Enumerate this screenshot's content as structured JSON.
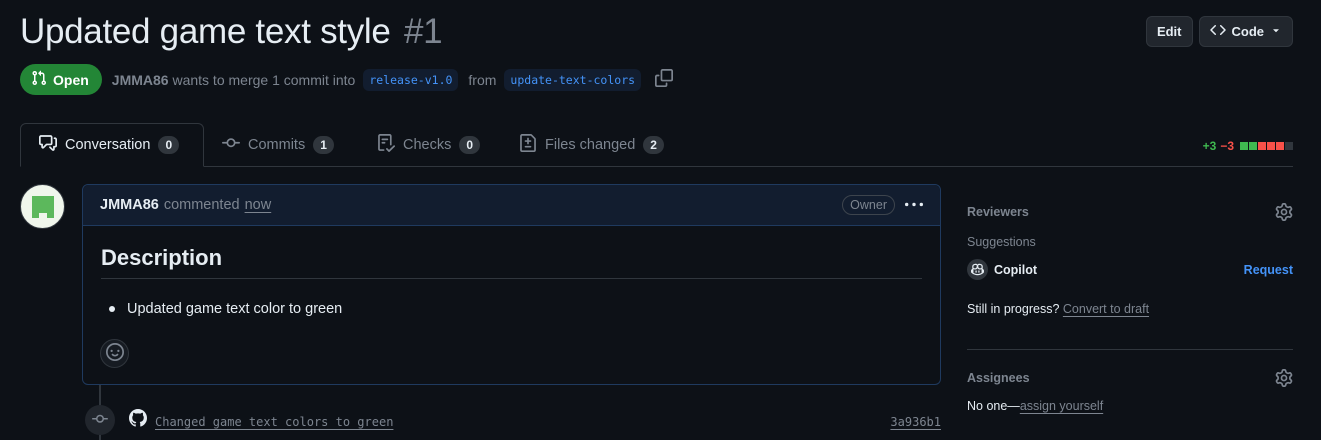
{
  "pr": {
    "title": "Updated game text style",
    "number": "#1",
    "state": "Open",
    "author": "JMMA86",
    "merge_text": "wants to merge 1 commit into",
    "base_branch": "release-v1.0",
    "from_text": "from",
    "head_branch": "update-text-colors"
  },
  "header_buttons": {
    "edit": "Edit",
    "code": "Code"
  },
  "tabs": [
    {
      "label": "Conversation",
      "count": "0",
      "active": true,
      "icon": "comment-discussion-icon"
    },
    {
      "label": "Commits",
      "count": "1",
      "active": false,
      "icon": "git-commit-icon"
    },
    {
      "label": "Checks",
      "count": "0",
      "active": false,
      "icon": "checklist-icon"
    },
    {
      "label": "Files changed",
      "count": "2",
      "active": false,
      "icon": "file-diff-icon"
    }
  ],
  "diffstat": {
    "additions": "+3",
    "deletions": "−3",
    "blocks": [
      "add",
      "add",
      "del",
      "del",
      "del",
      "neutral"
    ],
    "colors": {
      "add": "#3fb950",
      "del": "#f85149",
      "neutral": "#30363d"
    }
  },
  "comment": {
    "author": "JMMA86",
    "action": "commented",
    "time": "now",
    "badge": "Owner",
    "heading": "Description",
    "items": [
      "Updated game text color to green"
    ]
  },
  "timeline": {
    "commit_message": "Changed game text colors to green",
    "commit_sha": "3a936b1"
  },
  "sidebar": {
    "reviewers": {
      "heading": "Reviewers",
      "suggestions_label": "Suggestions",
      "suggested": "Copilot",
      "request_label": "Request"
    },
    "draft": {
      "text": "Still in progress?",
      "link": "Convert to draft"
    },
    "assignees": {
      "heading": "Assignees",
      "none_text": "No one—",
      "link": "assign yourself"
    }
  },
  "colors": {
    "background": "#0d1117",
    "open_state": "#238636",
    "link": "#4493f8",
    "muted": "#7d8590"
  }
}
